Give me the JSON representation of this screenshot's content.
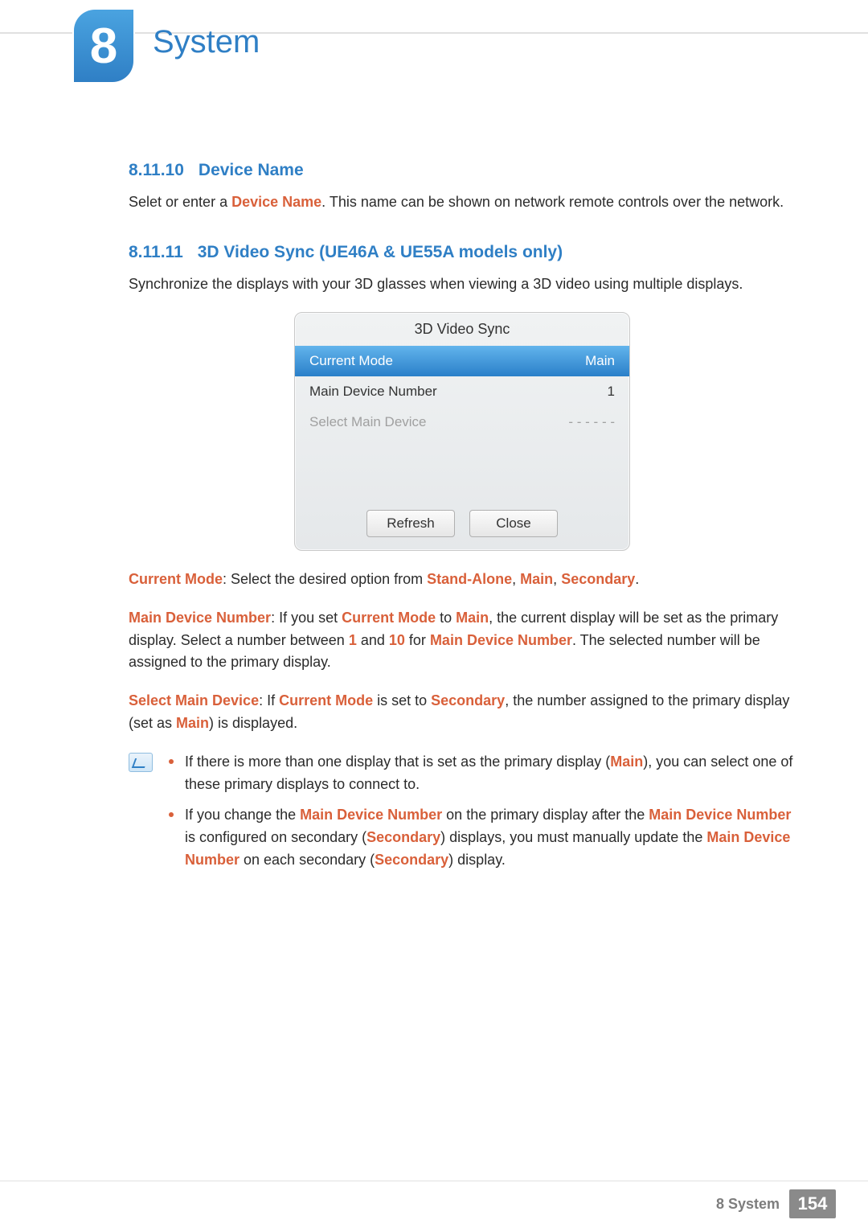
{
  "chapter": {
    "number": "8",
    "title": "System"
  },
  "sections": {
    "s1": {
      "num": "8.11.10",
      "title": "Device Name"
    },
    "s2": {
      "num": "8.11.11",
      "title": "3D Video Sync (UE46A & UE55A models only)"
    }
  },
  "text": {
    "s1_prefix": "Selet or enter a ",
    "s1_hl1": "Device Name",
    "s1_suffix": ". This name can be shown on network remote controls over the network.",
    "s2_intro": "Synchronize the displays with your 3D glasses when viewing a 3D video using multiple displays.",
    "p1_hl1": "Current Mode",
    "p1_a": ": Select the desired option from ",
    "p1_hl2": "Stand-Alone",
    "p1_sep": ", ",
    "p1_hl3": "Main",
    "p1_hl4": "Secondary",
    "p1_end": ".",
    "p2_hl1": "Main Device Number",
    "p2_a": ": If you set ",
    "p2_hl2": "Current Mode",
    "p2_b": " to ",
    "p2_hl3": "Main",
    "p2_c": ", the current display will be set as the primary display. Select a number between ",
    "p2_hl4": "1",
    "p2_d": " and ",
    "p2_hl5": "10",
    "p2_e": " for ",
    "p2_hl6": "Main Device Number",
    "p2_f": ". The selected number will be assigned to the primary display.",
    "p3_hl1": "Select Main Device",
    "p3_a": ": If ",
    "p3_hl2": "Current Mode",
    "p3_b": " is set to ",
    "p3_hl3": "Secondary",
    "p3_c": ", the number assigned to the primary display (set as ",
    "p3_hl4": "Main",
    "p3_d": ") is displayed.",
    "n1_a": "If there is more than one display that is set as the primary display (",
    "n1_hl1": "Main",
    "n1_b": "), you can select one of these primary displays to connect to.",
    "n2_a": "If you change the ",
    "n2_hl1": "Main Device Number",
    "n2_b": " on the primary display after the ",
    "n2_hl2": "Main Device Number",
    "n2_c": " is configured on secondary (",
    "n2_hl3": "Secondary",
    "n2_d": ") displays, you must manually update the ",
    "n2_hl4": "Main Device Number",
    "n2_e": " on each secondary (",
    "n2_hl5": "Secondary",
    "n2_f": ") display."
  },
  "osd": {
    "title": "3D Video Sync",
    "row1": {
      "label": "Current Mode",
      "value": "Main"
    },
    "row2": {
      "label": "Main Device Number",
      "value": "1"
    },
    "row3": {
      "label": "Select Main Device",
      "value": "- - - - - -"
    },
    "refresh": "Refresh",
    "close": "Close"
  },
  "footer": {
    "label": "8 System",
    "page": "154"
  }
}
